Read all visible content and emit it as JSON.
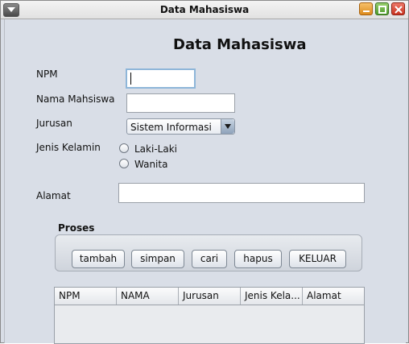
{
  "window": {
    "title": "Data Mahasiswa"
  },
  "form": {
    "heading": "Data Mahasiswa",
    "npm_label": "NPM",
    "npm_value": "",
    "nama_label": "Nama Mahsiswa",
    "nama_value": "",
    "jurusan_label": "Jurusan",
    "jurusan_selected": "Sistem Informasi",
    "gender_label": "Jenis Kelamin",
    "gender_options": [
      "Laki-Laki",
      "Wanita"
    ],
    "alamat_label": "Alamat",
    "alamat_value": ""
  },
  "proses": {
    "title": "Proses",
    "buttons": [
      "tambah",
      "simpan",
      "cari",
      "hapus",
      "KELUAR"
    ]
  },
  "table": {
    "columns": [
      "NPM",
      "NAMA",
      "Jurusan",
      "Jenis Kela...",
      "Alamat"
    ],
    "rows": []
  },
  "icons": {
    "system_menu": "chevron-down-icon",
    "minimize": "minimize-icon",
    "maximize": "maximize-icon",
    "close": "close-icon",
    "dropdown": "triangle-down-icon"
  },
  "colors": {
    "window_bg": "#d9dee7",
    "minimize": "#dc8a1c",
    "maximize": "#4c9a2a",
    "close": "#c8321f",
    "focus_border": "#8eb6d9"
  }
}
